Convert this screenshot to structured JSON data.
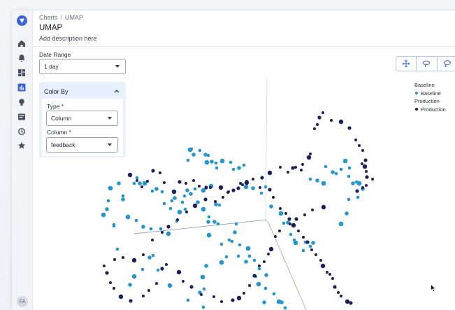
{
  "breadcrumb": {
    "parent": "Charts",
    "current": "UMAP"
  },
  "page": {
    "title": "UMAP",
    "description": "Add description here"
  },
  "date_range": {
    "label": "Date Range",
    "value": "1 day"
  },
  "color_by": {
    "header": "Color By",
    "type_label": "Type *",
    "type_value": "Column",
    "column_label": "Column *",
    "column_value": "feedback"
  },
  "toolbar": {
    "tools": [
      "pan-icon",
      "lasso-icon",
      "lasso-select-icon"
    ]
  },
  "legend": {
    "groups": [
      {
        "title": "Baseline",
        "item": "Baseline",
        "color": "#2496cc"
      },
      {
        "title": "Production",
        "item": "Production",
        "color": "#1c1f5a"
      }
    ]
  },
  "user": {
    "initials": "FA"
  },
  "colors": {
    "accent": "#3b64d8",
    "baseline": "#2496cc",
    "production": "#1c1f5a"
  },
  "points": {
    "baseline": [
      [
        148,
        307
      ],
      [
        163,
        323
      ],
      [
        155,
        287
      ],
      [
        176,
        285
      ],
      [
        176,
        280
      ],
      [
        158,
        269
      ],
      [
        170,
        262
      ],
      [
        192,
        262
      ],
      [
        196,
        254
      ],
      [
        200,
        262
      ],
      [
        207,
        262
      ],
      [
        218,
        273
      ],
      [
        224,
        270
      ],
      [
        232,
        274
      ],
      [
        246,
        287
      ],
      [
        257,
        303
      ],
      [
        261,
        289
      ],
      [
        264,
        280
      ],
      [
        268,
        272
      ],
      [
        269,
        229
      ],
      [
        272,
        214
      ],
      [
        277,
        221
      ],
      [
        274,
        213
      ],
      [
        286,
        215
      ],
      [
        294,
        221
      ],
      [
        296,
        232
      ],
      [
        309,
        233
      ],
      [
        303,
        231
      ],
      [
        298,
        222
      ],
      [
        310,
        240
      ],
      [
        318,
        230
      ],
      [
        330,
        232
      ],
      [
        334,
        242
      ],
      [
        342,
        240
      ],
      [
        349,
        236
      ],
      [
        352,
        267
      ],
      [
        362,
        269
      ],
      [
        374,
        276
      ],
      [
        380,
        267
      ],
      [
        388,
        295
      ],
      [
        402,
        305
      ],
      [
        406,
        319
      ],
      [
        412,
        318
      ],
      [
        416,
        335
      ],
      [
        421,
        343
      ],
      [
        423,
        347
      ],
      [
        434,
        358
      ],
      [
        444,
        352
      ],
      [
        448,
        347
      ],
      [
        437,
        346
      ],
      [
        302,
        266
      ],
      [
        309,
        292
      ],
      [
        314,
        293
      ],
      [
        312,
        320
      ],
      [
        298,
        317
      ],
      [
        299,
        336
      ],
      [
        328,
        343
      ],
      [
        336,
        332
      ],
      [
        338,
        320
      ],
      [
        317,
        349
      ],
      [
        317,
        375
      ],
      [
        324,
        367
      ],
      [
        341,
        366
      ],
      [
        352,
        374
      ],
      [
        366,
        395
      ],
      [
        370,
        406
      ],
      [
        378,
        432
      ],
      [
        380,
        412
      ],
      [
        357,
        366
      ],
      [
        295,
        380
      ],
      [
        290,
        396
      ],
      [
        292,
        413
      ],
      [
        286,
        418
      ],
      [
        291,
        439
      ],
      [
        269,
        429
      ],
      [
        243,
        408
      ],
      [
        226,
        386
      ],
      [
        219,
        365
      ],
      [
        214,
        368
      ],
      [
        204,
        385
      ],
      [
        192,
        395
      ],
      [
        186,
        407
      ],
      [
        168,
        356
      ],
      [
        163,
        321
      ],
      [
        153,
        299
      ],
      [
        183,
        310
      ],
      [
        195,
        315
      ],
      [
        205,
        324
      ],
      [
        216,
        327
      ],
      [
        230,
        327
      ],
      [
        241,
        334
      ],
      [
        253,
        316
      ],
      [
        265,
        299
      ],
      [
        273,
        277
      ],
      [
        279,
        270
      ],
      [
        291,
        272
      ],
      [
        250,
        283
      ],
      [
        244,
        298
      ],
      [
        235,
        291
      ],
      [
        283,
        289
      ],
      [
        291,
        299
      ],
      [
        299,
        310
      ],
      [
        307,
        317
      ],
      [
        332,
        345
      ],
      [
        343,
        350
      ],
      [
        355,
        355
      ],
      [
        364,
        372
      ],
      [
        371,
        384
      ],
      [
        381,
        393
      ],
      [
        392,
        420
      ],
      [
        399,
        431
      ],
      [
        403,
        432
      ],
      [
        408,
        440
      ],
      [
        444,
        256
      ],
      [
        454,
        258
      ],
      [
        463,
        262
      ],
      [
        466,
        238
      ],
      [
        476,
        246
      ],
      [
        481,
        248
      ],
      [
        488,
        242
      ],
      [
        494,
        230
      ],
      [
        500,
        240
      ],
      [
        499,
        252
      ],
      [
        505,
        262
      ],
      [
        510,
        260
      ],
      [
        514,
        262
      ],
      [
        519,
        270
      ],
      [
        512,
        282
      ],
      [
        499,
        285
      ],
      [
        496,
        305
      ],
      [
        488,
        320
      ]
    ],
    "production": [
      [
        186,
        250
      ],
      [
        196,
        258
      ],
      [
        203,
        267
      ],
      [
        211,
        259
      ],
      [
        219,
        244
      ],
      [
        229,
        247
      ],
      [
        235,
        261
      ],
      [
        249,
        274
      ],
      [
        257,
        260
      ],
      [
        266,
        262
      ],
      [
        277,
        258
      ],
      [
        285,
        266
      ],
      [
        295,
        268
      ],
      [
        301,
        268
      ],
      [
        316,
        268
      ],
      [
        327,
        274
      ],
      [
        341,
        269
      ],
      [
        347,
        264
      ],
      [
        353,
        259
      ],
      [
        362,
        256
      ],
      [
        375,
        254
      ],
      [
        386,
        247
      ],
      [
        401,
        239
      ],
      [
        412,
        246
      ],
      [
        419,
        240
      ],
      [
        423,
        239
      ],
      [
        431,
        243
      ],
      [
        433,
        235
      ],
      [
        442,
        225
      ],
      [
        444,
        220
      ],
      [
        450,
        184
      ],
      [
        454,
        178
      ],
      [
        457,
        168
      ],
      [
        462,
        161
      ],
      [
        474,
        172
      ],
      [
        488,
        174
      ],
      [
        500,
        183
      ],
      [
        509,
        200
      ],
      [
        514,
        208
      ],
      [
        519,
        215
      ],
      [
        523,
        229
      ],
      [
        518,
        234
      ],
      [
        522,
        238
      ],
      [
        524,
        245
      ],
      [
        525,
        253
      ],
      [
        533,
        256
      ],
      [
        524,
        265
      ],
      [
        519,
        268
      ],
      [
        511,
        273
      ],
      [
        463,
        296
      ],
      [
        447,
        300
      ],
      [
        436,
        307
      ],
      [
        424,
        313
      ],
      [
        415,
        320
      ],
      [
        400,
        330
      ],
      [
        394,
        338
      ],
      [
        388,
        356
      ],
      [
        384,
        363
      ],
      [
        378,
        374
      ],
      [
        371,
        380
      ],
      [
        364,
        394
      ],
      [
        357,
        408
      ],
      [
        349,
        419
      ],
      [
        342,
        426
      ],
      [
        333,
        429
      ],
      [
        317,
        431
      ],
      [
        306,
        424
      ],
      [
        288,
        421
      ],
      [
        274,
        410
      ],
      [
        262,
        402
      ],
      [
        256,
        389
      ],
      [
        238,
        378
      ],
      [
        232,
        384
      ],
      [
        224,
        405
      ],
      [
        213,
        415
      ],
      [
        205,
        423
      ],
      [
        187,
        430
      ],
      [
        173,
        424
      ],
      [
        163,
        412
      ],
      [
        158,
        404
      ],
      [
        153,
        390
      ],
      [
        149,
        380
      ],
      [
        164,
        371
      ],
      [
        176,
        368
      ],
      [
        192,
        372
      ],
      [
        205,
        364
      ],
      [
        218,
        343
      ],
      [
        232,
        332
      ],
      [
        241,
        324
      ],
      [
        254,
        314
      ],
      [
        267,
        303
      ],
      [
        279,
        294
      ],
      [
        294,
        285
      ],
      [
        308,
        288
      ],
      [
        319,
        282
      ],
      [
        326,
        275
      ],
      [
        334,
        272
      ],
      [
        344,
        262
      ],
      [
        353,
        261
      ],
      [
        372,
        268
      ],
      [
        386,
        271
      ],
      [
        391,
        282
      ],
      [
        401,
        298
      ],
      [
        409,
        305
      ],
      [
        414,
        313
      ],
      [
        420,
        322
      ],
      [
        427,
        330
      ],
      [
        434,
        339
      ],
      [
        440,
        346
      ],
      [
        446,
        357
      ],
      [
        452,
        364
      ],
      [
        459,
        372
      ],
      [
        462,
        380
      ],
      [
        468,
        389
      ],
      [
        472,
        392
      ],
      [
        476,
        398
      ],
      [
        479,
        410
      ],
      [
        484,
        418
      ],
      [
        488,
        423
      ],
      [
        497,
        431
      ],
      [
        502,
        433
      ]
    ]
  }
}
